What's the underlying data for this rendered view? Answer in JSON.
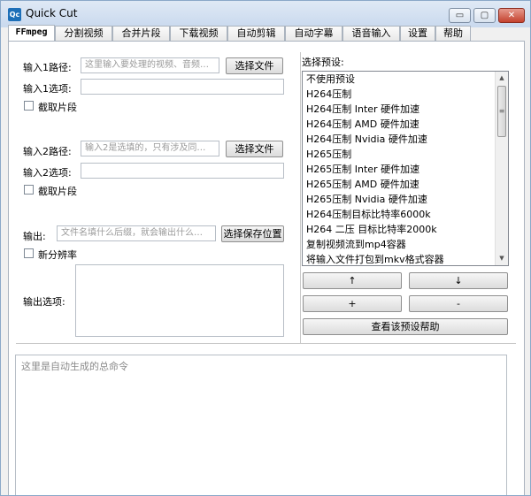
{
  "window": {
    "icon_text": "Qc",
    "title": "Quick Cut",
    "min_glyph": "▭",
    "max_glyph": "▢",
    "close_glyph": "✕"
  },
  "tabs": [
    {
      "label": "FFmpeg",
      "active": true
    },
    {
      "label": "分割视频"
    },
    {
      "label": "合并片段"
    },
    {
      "label": "下载视频"
    },
    {
      "label": "自动剪辑"
    },
    {
      "label": "自动字幕"
    },
    {
      "label": "语音输入"
    },
    {
      "label": "设置"
    },
    {
      "label": "帮助"
    }
  ],
  "input1": {
    "path_label": "输入1路径:",
    "path_placeholder": "这里输入要处理的视频、音频…",
    "select_button": "选择文件",
    "options_label": "输入1选项:",
    "options_value": "",
    "clip_label": "截取片段"
  },
  "input2": {
    "path_label": "输入2路径:",
    "path_placeholder": "输入2是选填的，只有涉及同…",
    "select_button": "选择文件",
    "options_label": "输入2选项:",
    "options_value": "",
    "clip_label": "截取片段"
  },
  "output": {
    "label": "输出:",
    "placeholder": "文件名填什么后缀，就会输出什么…",
    "save_button": "选择保存位置",
    "resolution_label": "新分辨率",
    "options_label": "输出选项:",
    "options_value": ""
  },
  "presets": {
    "label": "选择预设:",
    "items": [
      "不使用预设",
      "H264压制",
      "H264压制 Inter 硬件加速",
      "H264压制 AMD 硬件加速",
      "H264压制 Nvidia 硬件加速",
      "H265压制",
      "H265压制 Inter 硬件加速",
      "H265压制 AMD 硬件加速",
      "H265压制 Nvidia 硬件加速",
      "H264压制目标比特率6000k",
      "H264 二压 目标比特率2000k",
      "复制视频流到mp4容器",
      "将输入文件打包到mkv格式容器"
    ],
    "scroll_up_glyph": "▲",
    "scroll_down_glyph": "▼",
    "thumb_glyph": "≡",
    "move_up_button": "↑",
    "move_down_button": "↓",
    "add_button": "+",
    "remove_button": "-",
    "help_button": "查看该预设帮助"
  },
  "command": {
    "placeholder": "这里是自动生成的总命令"
  }
}
